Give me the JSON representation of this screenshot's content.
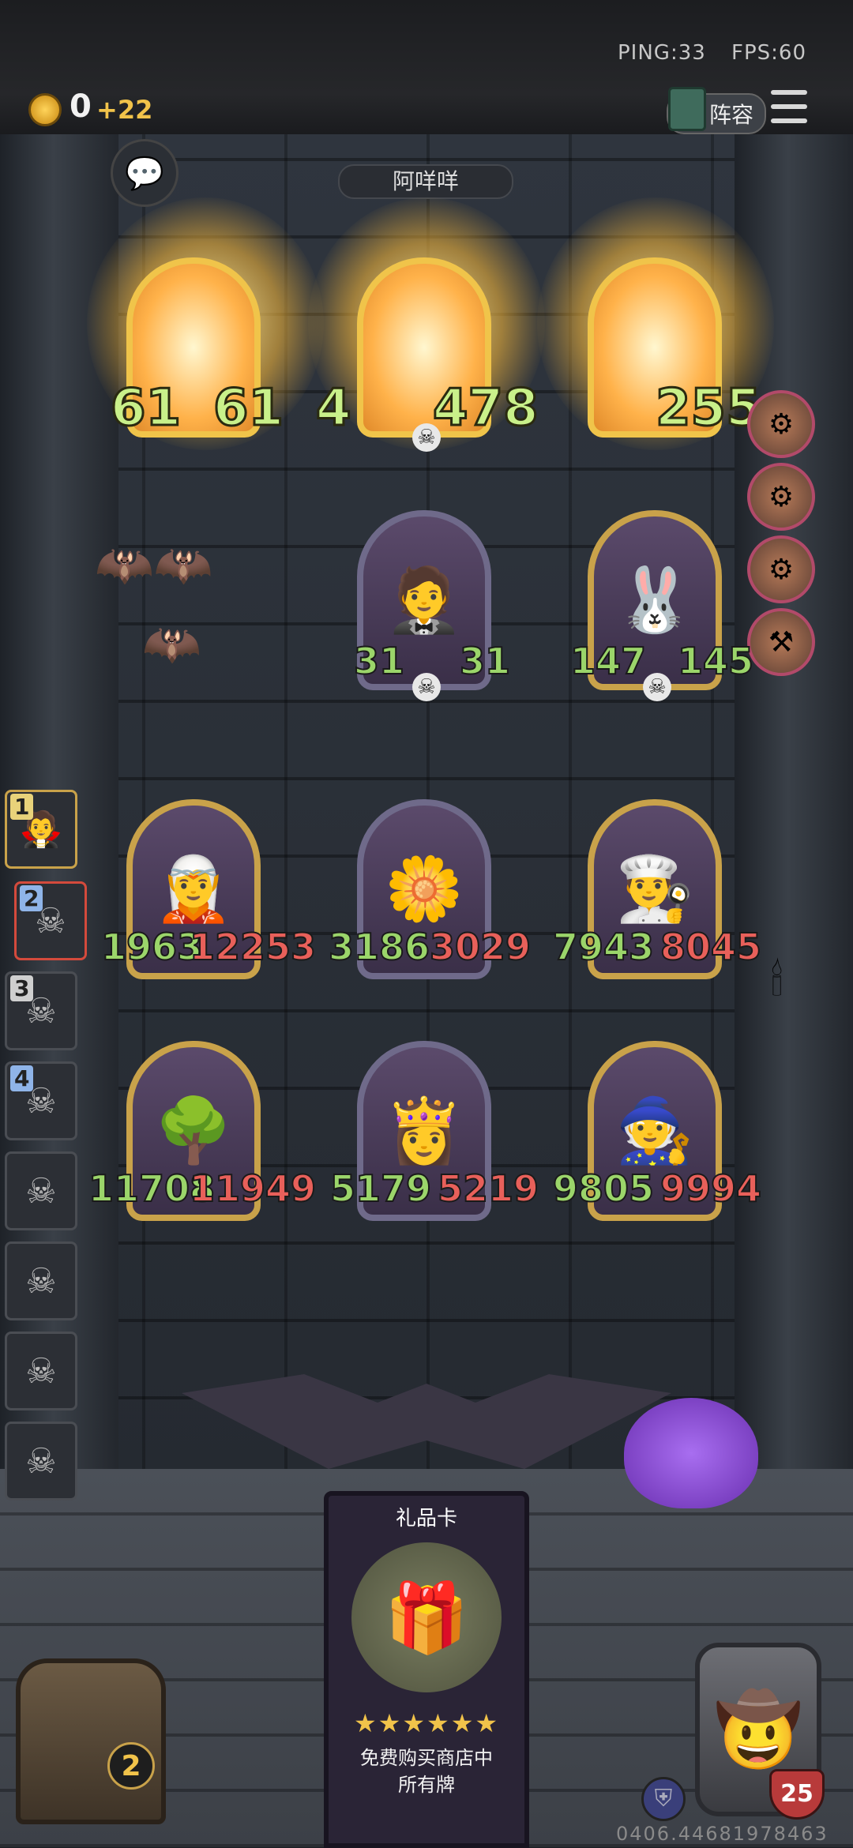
{
  "hud": {
    "ping": "PING:33",
    "fps": "FPS:60",
    "gold": "0",
    "gold_gain": "+22",
    "lineup_label": "阵容",
    "accent_gold": "#f1c34a"
  },
  "opponent": {
    "name": "阿咩咩"
  },
  "enemy_row1": [
    {
      "atk": "61",
      "hp": "61",
      "state": "attacking-glow"
    },
    {
      "atk": "478",
      "hp": "478",
      "partial_left": "4",
      "state": "attacking-glow"
    },
    {
      "atk": "255",
      "hp": "255",
      "state": "attacking-glow"
    }
  ],
  "enemy_row2": [
    {
      "atk": "31",
      "hp": "31",
      "portrait_icon": "chef-old-man-icon"
    },
    {
      "atk": "147",
      "hp": "145",
      "portrait_icon": "masked-rabbit-icon"
    }
  ],
  "player_row1": [
    {
      "atk": "1963",
      "hp": "12253",
      "portrait_icon": "elf-girl-icon"
    },
    {
      "atk": "3186",
      "hp": "3029",
      "portrait_icon": "flower-icon"
    },
    {
      "atk": "7943",
      "hp": "8045",
      "portrait_icon": "chef-boy-icon"
    }
  ],
  "player_row2": [
    {
      "atk": "11708",
      "hp": "11949",
      "portrait_icon": "tree-icon"
    },
    {
      "atk": "5179",
      "hp": "5219",
      "portrait_icon": "purple-dress-girl-icon"
    },
    {
      "atk": "9805",
      "hp": "9994",
      "portrait_icon": "elf-witch-icon"
    }
  ],
  "roster": [
    {
      "num": "1"
    },
    {
      "num": "2"
    },
    {
      "num": "3"
    },
    {
      "num": "4"
    },
    {
      "num": ""
    },
    {
      "num": ""
    },
    {
      "num": ""
    },
    {
      "num": ""
    }
  ],
  "gift_card": {
    "title": "礼品卡",
    "stars": "★★★★★★",
    "desc_line1": "免费购买商店中",
    "desc_line2": "所有牌"
  },
  "chest": {
    "count": "2"
  },
  "hero": {
    "health": "25"
  },
  "footer": {
    "id": "0406.44681978463"
  }
}
